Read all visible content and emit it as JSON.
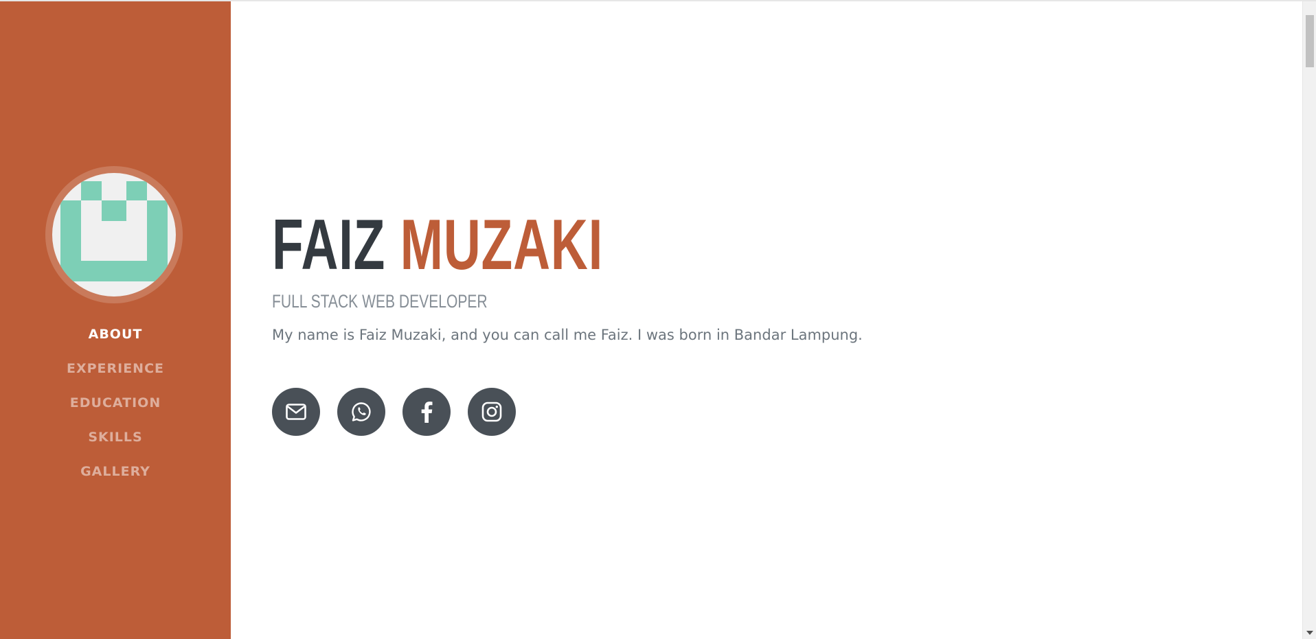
{
  "profile": {
    "first_name": "FAIZ",
    "last_name": "MUZAKI",
    "title": "FULL STACK WEB DEVELOPER",
    "bio": "My name is Faiz Muzaki, and you can call me Faiz. I was born in Bandar Lampung."
  },
  "sidebar": {
    "avatar_icon": "logo-icon",
    "items": [
      {
        "label": "ABOUT",
        "active": true
      },
      {
        "label": "EXPERIENCE",
        "active": false
      },
      {
        "label": "EDUCATION",
        "active": false
      },
      {
        "label": "SKILLS",
        "active": false
      },
      {
        "label": "GALLERY",
        "active": false
      }
    ]
  },
  "social": [
    {
      "icon": "envelope-icon"
    },
    {
      "icon": "whatsapp-icon"
    },
    {
      "icon": "facebook-icon"
    },
    {
      "icon": "instagram-icon"
    }
  ],
  "colors": {
    "sidebar": "#bd5d38",
    "accent": "#bd5d38",
    "name_dark": "#343a40",
    "social_bg": "#495057",
    "avatar_logo": "#7dcfb6"
  }
}
